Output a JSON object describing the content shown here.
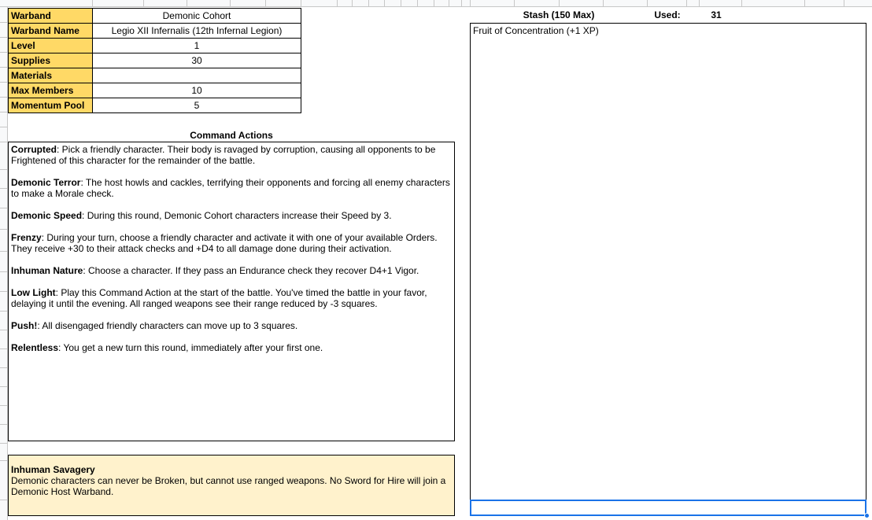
{
  "warband": [
    {
      "label": "Warband",
      "value": "Demonic Cohort"
    },
    {
      "label": "Warband Name",
      "value": "Legio XII Infernalis (12th Infernal Legion)"
    },
    {
      "label": "Level",
      "value": "1"
    },
    {
      "label": "Supplies",
      "value": "30"
    },
    {
      "label": "Materials",
      "value": ""
    },
    {
      "label": "Max Members",
      "value": "10"
    },
    {
      "label": "Momentum Pool",
      "value": "5"
    }
  ],
  "command_actions": {
    "title": "Command Actions",
    "items": [
      {
        "name": "Corrupted",
        "text": ": Pick a friendly character. Their body is ravaged by corruption, causing all opponents to be Frightened of this character for the remainder of the battle."
      },
      {
        "name": "Demonic Terror",
        "text": ": The host howls and cackles, terrifying their opponents and forcing all enemy characters to make a Morale check."
      },
      {
        "name": "Demonic Speed",
        "text": ": During this round, Demonic Cohort characters increase their Speed by 3."
      },
      {
        "name": "Frenzy",
        "text": ": During your turn, choose a friendly character and activate it with one of your available Orders. They receive +30 to their attack checks and +D4 to all damage done during their activation."
      },
      {
        "name": "Inhuman Nature",
        "text": ": Choose a character. If they pass an Endurance check they recover D4+1 Vigor."
      },
      {
        "name": "Low Light",
        "text": ": Play this Command Action at the start of the battle. You've timed the battle in your favor, delaying it until the evening. All ranged weapons see their range reduced by -3 squares."
      },
      {
        "name": "Push!",
        "text": ": All disengaged friendly characters can move up to 3 squares."
      },
      {
        "name": "Relentless",
        "text": ": You get a new turn this round, immediately after your first one."
      }
    ]
  },
  "savagery": {
    "title": "Inhuman Savagery",
    "text": "Demonic characters can never be Broken, but cannot use ranged weapons. No Sword for Hire will join a Demonic Host Warband."
  },
  "stash": {
    "title": "Stash (150 Max)",
    "used_label": "Used:",
    "used_value": "31",
    "items": [
      "Fruit of Concentration (+1 XP)"
    ]
  },
  "colors": {
    "label_fill": "#ffd966",
    "savagery_fill": "#fff2cc",
    "selection": "#1a73e8"
  }
}
